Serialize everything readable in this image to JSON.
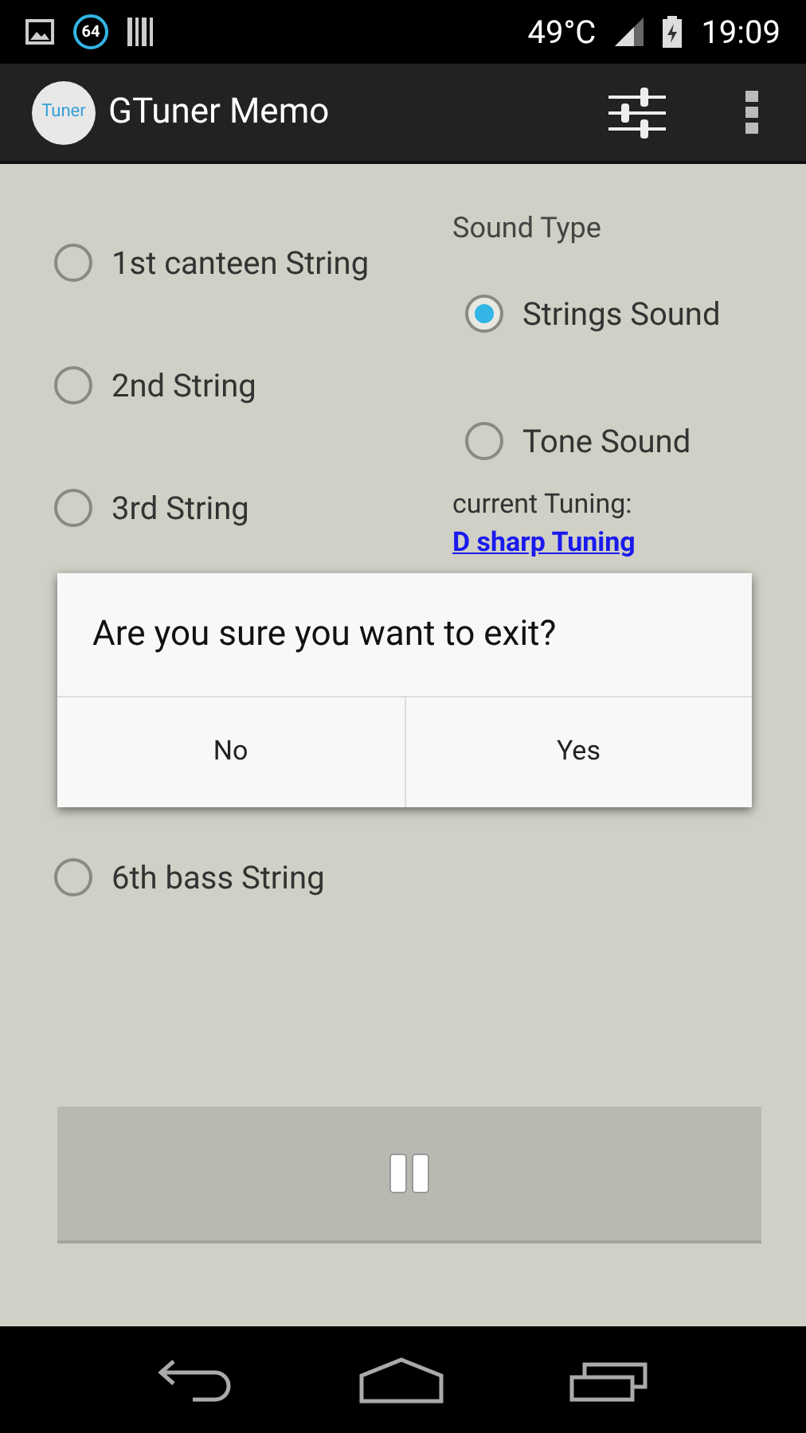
{
  "status_bar": {
    "notification_count": "64",
    "temperature": "49°C",
    "time": "19:09"
  },
  "app_bar": {
    "logo_text": "Tuner",
    "title": "GTuner Memo"
  },
  "strings": [
    {
      "label": "1st canteen String",
      "selected": false
    },
    {
      "label": "2nd String",
      "selected": false
    },
    {
      "label": "3rd String",
      "selected": false
    },
    {
      "label": "6th bass String",
      "selected": false
    }
  ],
  "sound_type": {
    "label": "Sound Type",
    "options": [
      {
        "label": "Strings Sound",
        "selected": true
      },
      {
        "label": "Tone Sound",
        "selected": false
      }
    ]
  },
  "current_tuning": {
    "label": "current Tuning:",
    "value": "D sharp Tuning"
  },
  "dialog": {
    "message": "Are you sure you want to exit?",
    "buttons": [
      "No",
      "Yes"
    ]
  }
}
